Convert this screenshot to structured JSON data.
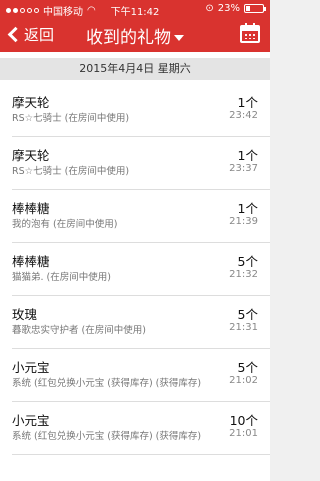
{
  "status_bar": {
    "carrier": "中国移动",
    "time": "下午11:42",
    "battery": "23%",
    "battery_level": 0.23
  },
  "nav": {
    "back_label": "返回",
    "title": "收到的礼物",
    "dropdown_icon": "caret-down-icon",
    "calendar_icon": "calendar-icon"
  },
  "date_header": "2015年4月4日 星期六",
  "gifts": [
    {
      "name": "摩天轮",
      "sender": "RS☆七骑士 (在房间中使用)",
      "count": "1个",
      "time": "23:42"
    },
    {
      "name": "摩天轮",
      "sender": "RS☆七骑士 (在房间中使用)",
      "count": "1个",
      "time": "23:37"
    },
    {
      "name": "棒棒糖",
      "sender": "我的泡有 (在房间中使用)",
      "count": "1个",
      "time": "21:39"
    },
    {
      "name": "棒棒糖",
      "sender": "猫猫弟. (在房间中使用)",
      "count": "5个",
      "time": "21:32"
    },
    {
      "name": "玫瑰",
      "sender": "暮歌忠实守护者 (在房间中使用)",
      "count": "5个",
      "time": "21:31"
    },
    {
      "name": "小元宝",
      "sender": "系统 (红包兑换小元宝 (获得库存) (获得库存)",
      "count": "5个",
      "time": "21:02"
    },
    {
      "name": "小元宝",
      "sender": "系统 (红包兑换小元宝 (获得库存) (获得库存)",
      "count": "10个",
      "time": "21:01"
    }
  ]
}
